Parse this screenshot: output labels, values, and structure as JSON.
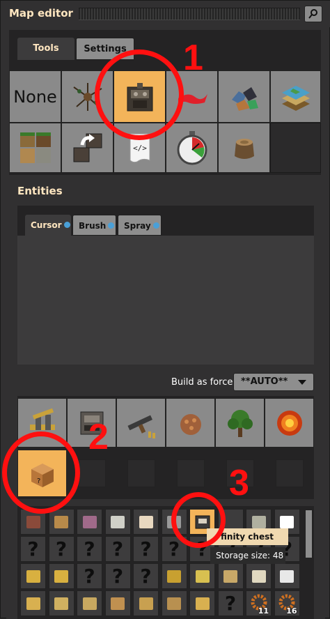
{
  "window": {
    "title": "Map editor",
    "search_icon": "magnifier-icon"
  },
  "tool_tabs": [
    {
      "label": "Tools",
      "active": true
    },
    {
      "label": "Settings",
      "active": false
    }
  ],
  "tools": {
    "row1": [
      {
        "name": "none",
        "label": "None"
      },
      {
        "name": "decoratives",
        "icon": "decorative-icon"
      },
      {
        "name": "entities",
        "icon": "assembling-machine-icon",
        "selected": true
      },
      {
        "name": "resources",
        "icon": "ore-icon"
      },
      {
        "name": "tiles",
        "icon": "tile-layers-icon"
      }
    ],
    "row2": [
      {
        "name": "cliffs",
        "icon": "soil-tiles-icon"
      },
      {
        "name": "clone",
        "icon": "clone-icon"
      },
      {
        "name": "scripting",
        "icon": "script-icon"
      },
      {
        "name": "time",
        "icon": "stopwatch-icon"
      },
      {
        "name": "trees",
        "icon": "stump-icon"
      }
    ]
  },
  "entities_section": {
    "title": "Entities",
    "subtabs": [
      {
        "label": "Cursor",
        "active": true
      },
      {
        "label": "Brush",
        "active": false
      },
      {
        "label": "Spray",
        "active": false
      }
    ],
    "build_as_force_label": "Build as force:",
    "force_value": "**AUTO**"
  },
  "categories": [
    "logistics-icon",
    "production-icon",
    "combat-icon",
    "enemies-icon",
    "environment-icon",
    "explosion-icon"
  ],
  "subgroups": [
    "other-chest-icon"
  ],
  "grid": {
    "row1": [
      {
        "k": "icon",
        "icon": "red-crate-icon"
      },
      {
        "k": "icon",
        "icon": "wooden-chest-icon"
      },
      {
        "k": "icon",
        "icon": "spider-icon"
      },
      {
        "k": "icon",
        "icon": "heat-icon"
      },
      {
        "k": "icon",
        "icon": "bone-icon"
      },
      {
        "k": "icon",
        "icon": "pipe-icon"
      },
      {
        "k": "icon",
        "icon": "infinity-chest-icon",
        "hl": true
      },
      {
        "k": "icon",
        "icon": "tooltip-covered"
      },
      {
        "k": "icon",
        "icon": "gears-icon"
      },
      {
        "k": "icon",
        "icon": "blank-white-icon"
      }
    ],
    "row2": [
      {
        "k": "q"
      },
      {
        "k": "q"
      },
      {
        "k": "q"
      },
      {
        "k": "q"
      },
      {
        "k": "q"
      },
      {
        "k": "q"
      },
      {
        "k": "q"
      },
      {
        "k": "q"
      },
      {
        "k": "q"
      },
      {
        "k": "q"
      }
    ],
    "row3": [
      {
        "k": "icon",
        "icon": "gold-chest-icon"
      },
      {
        "k": "icon",
        "icon": "gold-chest-icon"
      },
      {
        "k": "q"
      },
      {
        "k": "q"
      },
      {
        "k": "q"
      },
      {
        "k": "icon",
        "icon": "gear-bug-icon"
      },
      {
        "k": "icon",
        "icon": "yellow-gear-icon"
      },
      {
        "k": "icon",
        "icon": "canister-icon"
      },
      {
        "k": "icon",
        "icon": "paper-icon"
      },
      {
        "k": "icon",
        "icon": "ring-icon"
      }
    ],
    "row4": [
      {
        "k": "icon",
        "icon": "flag-icon"
      },
      {
        "k": "icon",
        "icon": "shard-icon"
      },
      {
        "k": "icon",
        "icon": "horn-icon"
      },
      {
        "k": "icon",
        "icon": "worm-icon"
      },
      {
        "k": "icon",
        "icon": "hook-icon"
      },
      {
        "k": "icon",
        "icon": "fish-icon"
      },
      {
        "k": "icon",
        "icon": "wing-icon"
      },
      {
        "k": "q"
      },
      {
        "k": "icon",
        "icon": "cog-icon",
        "num": "11"
      },
      {
        "k": "icon",
        "icon": "cog-icon",
        "num": "16"
      }
    ]
  },
  "tooltip": {
    "name": "finity chest",
    "storage": "Storage size: 48"
  },
  "annotations": [
    "1",
    "2",
    "3"
  ],
  "colors": {
    "selected": "#f3b45a",
    "annotation": "#ff1010",
    "title": "#ffe6c0"
  }
}
